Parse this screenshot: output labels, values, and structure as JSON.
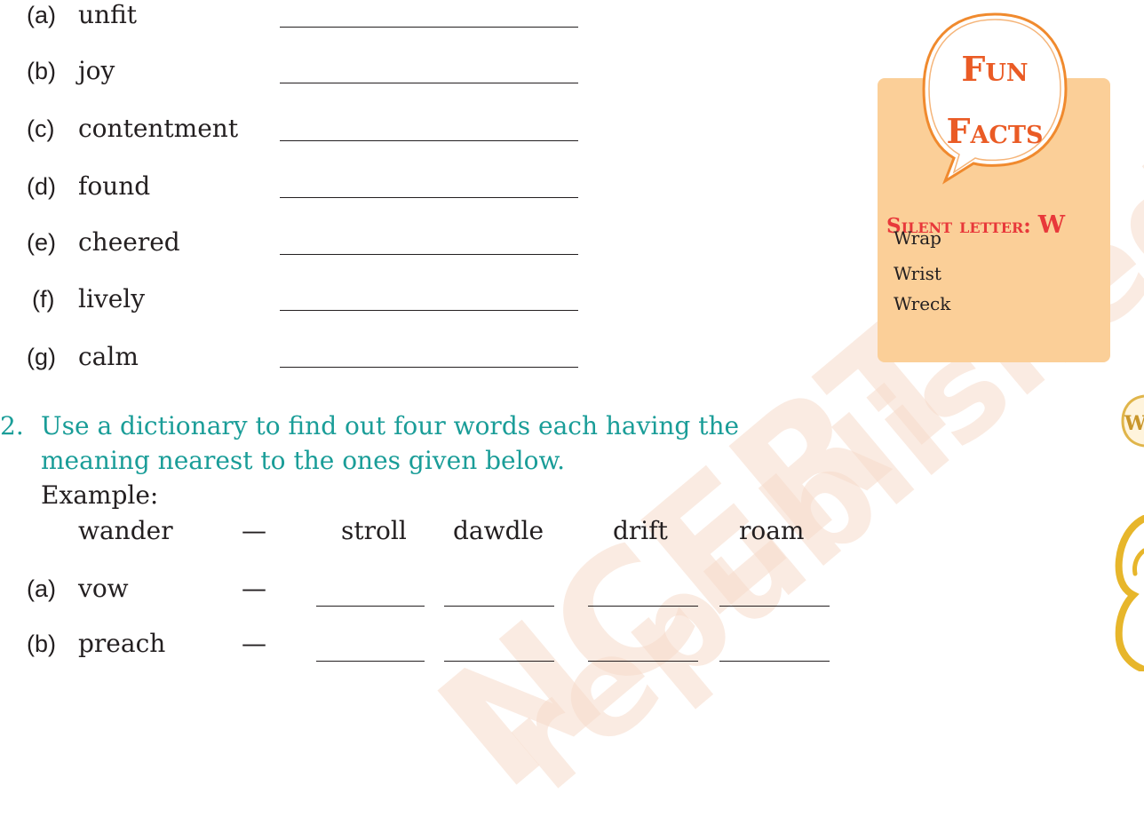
{
  "section1": {
    "rows": [
      {
        "label": "(a)",
        "word": "unfit"
      },
      {
        "label": "(b)",
        "word": "joy"
      },
      {
        "label": "(c)",
        "word": "contentment"
      },
      {
        "label": "(d)",
        "word": "found"
      },
      {
        "label": "(e)",
        "word": "cheered"
      },
      {
        "label": "(f)",
        "word": "lively"
      },
      {
        "label": "(g)",
        "word": "calm"
      }
    ]
  },
  "fun_facts": {
    "bubble_line1": "Fun",
    "bubble_line2": "Facts",
    "heading": "Silent letter:",
    "heading_letter": "W",
    "items": [
      "Wrap",
      "Wrist",
      "Wreck"
    ]
  },
  "question2": {
    "number": "2.",
    "text_line1": "Use a dictionary to find out four words each having the",
    "text_line2": "meaning nearest to the ones given below.",
    "example_label": "Example:",
    "example": {
      "word": "wander",
      "dash": "—",
      "answers": [
        "stroll",
        "dawdle",
        "drift",
        "roam"
      ]
    },
    "rows": [
      {
        "label": "(a)",
        "word": "vow",
        "dash": "—"
      },
      {
        "label": "(b)",
        "word": "preach",
        "dash": "—"
      }
    ]
  },
  "watermark": {
    "line1": "NCERT",
    "line2": "republished"
  },
  "colors": {
    "teal": "#1a9d98",
    "fun_box": "#fbcf98",
    "fun_title": "#ea5b25",
    "silent_heading": "#e8383a"
  }
}
